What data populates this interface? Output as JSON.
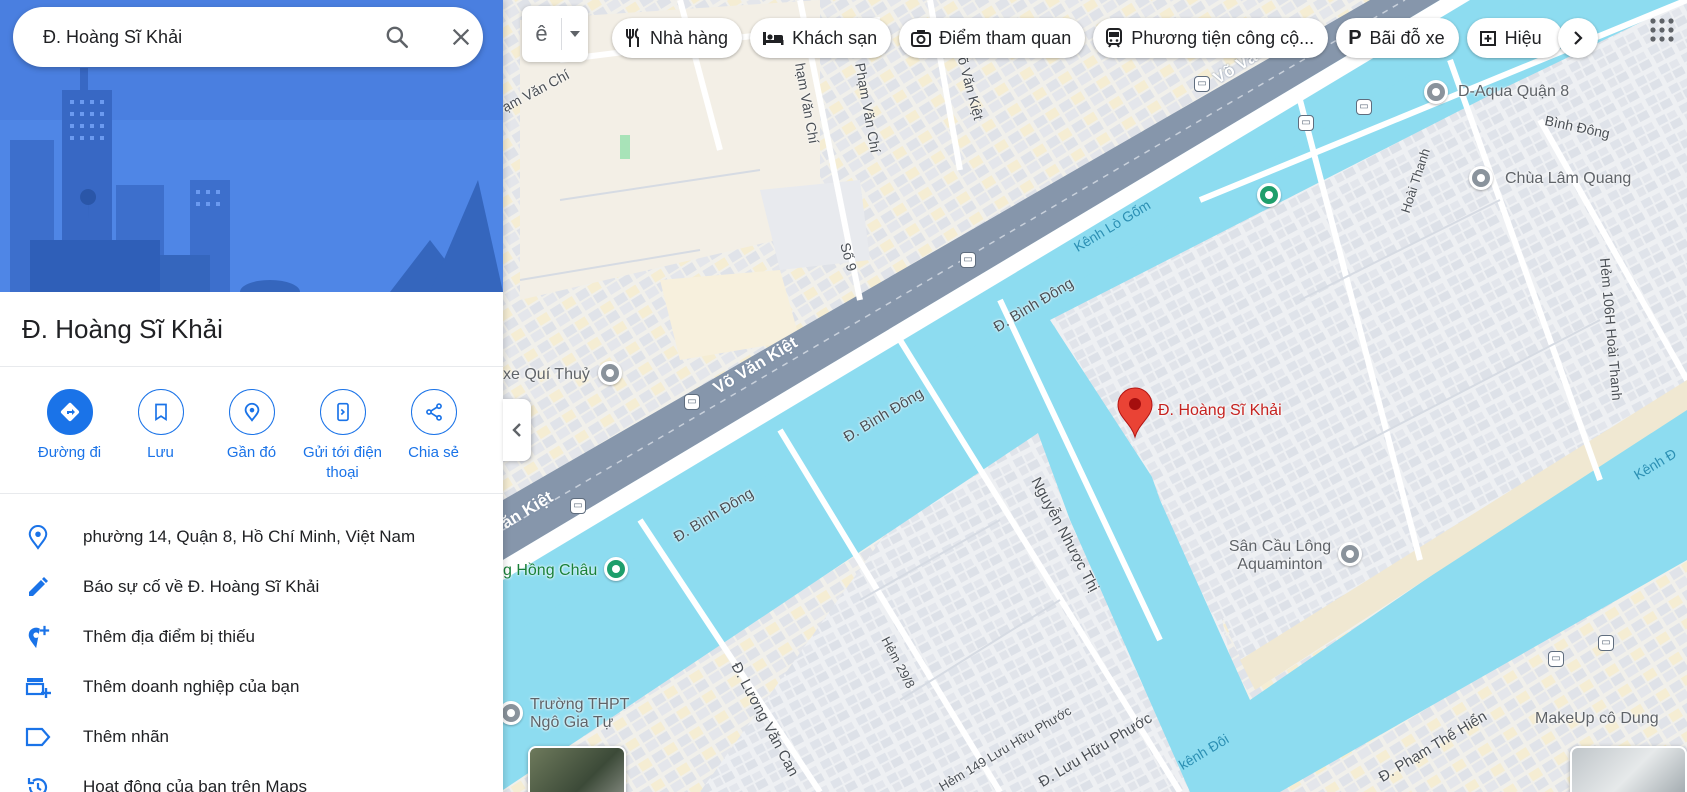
{
  "search": {
    "value": "Đ. Hoàng Sĩ Khải"
  },
  "place": {
    "title": "Đ. Hoàng Sĩ Khải"
  },
  "actions": [
    {
      "label": "Đường đi",
      "icon": "directions-icon"
    },
    {
      "label": "Lưu",
      "icon": "bookmark-icon"
    },
    {
      "label": "Gần đó",
      "icon": "nearby-icon"
    },
    {
      "label": "Gửi tới điện thoại",
      "icon": "send-to-phone-icon"
    },
    {
      "label": "Chia sẻ",
      "icon": "share-icon"
    }
  ],
  "info": [
    {
      "text": "phường 14, Quận 8, Hồ Chí Minh, Việt Nam",
      "icon": "location-pin-icon"
    },
    {
      "text": "Báo sự cố về Đ. Hoàng Sĩ Khải",
      "icon": "pencil-icon"
    },
    {
      "text": "Thêm địa điểm bị thiếu",
      "icon": "add-place-icon"
    },
    {
      "text": "Thêm doanh nghiệp của bạn",
      "icon": "add-business-icon"
    },
    {
      "text": "Thêm nhãn",
      "icon": "label-icon"
    },
    {
      "text": "Hoạt động của bạn trên Maps",
      "icon": "history-icon"
    }
  ],
  "layer_button": {
    "glyph": "ê"
  },
  "chips": [
    {
      "label": "Nhà hàng",
      "icon": "restaurant-icon"
    },
    {
      "label": "Khách sạn",
      "icon": "hotel-icon"
    },
    {
      "label": "Điểm tham quan",
      "icon": "camera-icon"
    },
    {
      "label": "Phương tiện công cộ...",
      "icon": "transit-icon"
    },
    {
      "label": "Bãi đỗ xe",
      "icon": "parking-icon"
    },
    {
      "label": "Hiệu",
      "icon": "pharmacy-icon"
    }
  ],
  "map": {
    "selected_pin": "Đ. Hoàng Sĩ Khải",
    "highway_labels": [
      "Võ Văn Kiệt",
      "Võ Vă",
      "ăn Kiệt"
    ],
    "road_labels": [
      "Đ. Bình Đông",
      "Đ. Bình Đông",
      "Đ. Bình Đông",
      "Nguyễn Nhược Thị",
      "Đ. Lương Văn Can",
      "Đ. Lưu Hữu Phước",
      "Hẻm 149 Lưu Hữu Phước",
      "Hẻm 29/8",
      "Đ. Phạm Thế Hiển",
      "Hẻm 106H Hoài Thanh",
      "Hoài Thanh",
      "Bình Đông",
      "Số 9",
      "hạm Văn Chí",
      "Phạm Văn Chí",
      "Võ Văn Kiệt",
      "ạm Văn Chí",
      "Đ. Pl",
      "Bình Đ",
      "Đ. Pl",
      "Đ. Ph"
    ],
    "water_labels": [
      "Kênh Lò Gốm",
      "kênh Đôi",
      "Kênh Đ"
    ],
    "pois": [
      {
        "label": "D-Aqua Quận 8",
        "color": "grey"
      },
      {
        "label": "Chùa Lâm Quang",
        "color": "grey"
      },
      {
        "label": "xe Quí Thuỷ",
        "color": "grey"
      },
      {
        "label": "g Hồng Châu",
        "color": "green"
      },
      {
        "label": "Sân Cầu Lông Aquaminton",
        "color": "grey"
      },
      {
        "label": "Trường THPT Ngô Gia Tự",
        "color": "grey"
      },
      {
        "label": "MakeUp cô Dung",
        "color": "grey"
      }
    ]
  },
  "colors": {
    "accent": "#1a73e8",
    "water": "#8ddcf0",
    "highway": "#8696ab",
    "land": "#f3efe6",
    "pin": "#ea4335"
  }
}
